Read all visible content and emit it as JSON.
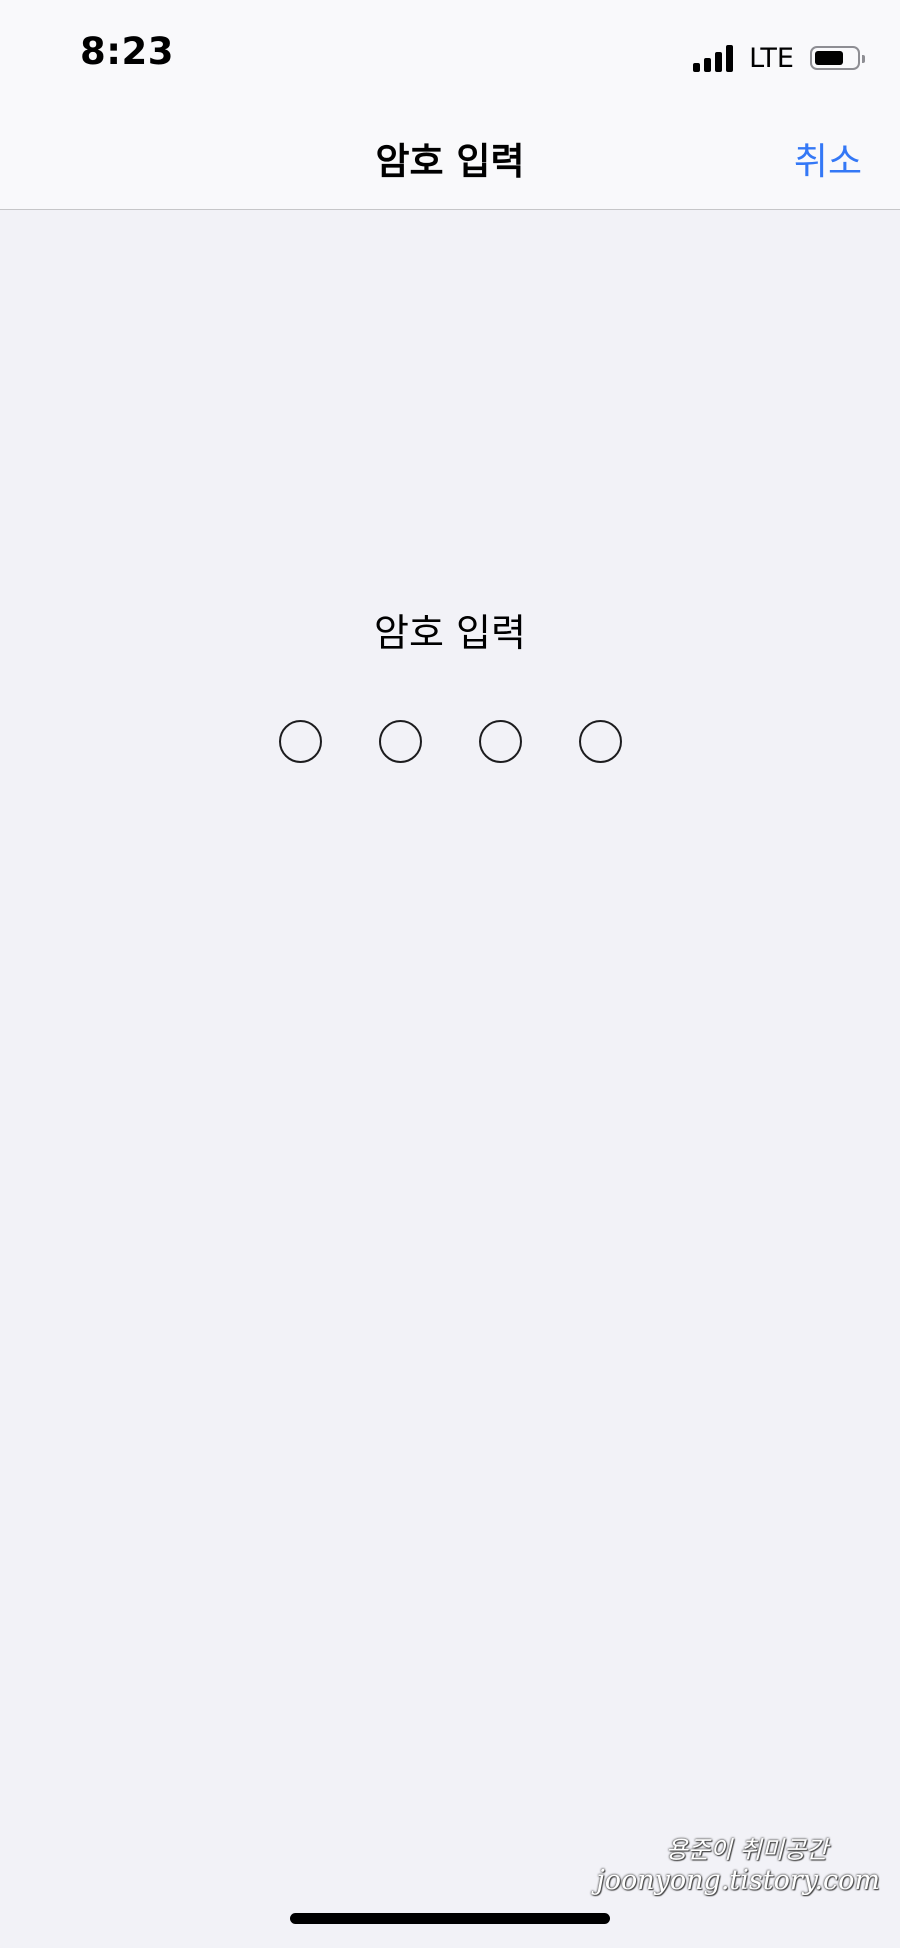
{
  "status_bar": {
    "time": "8:23",
    "network": "LTE",
    "icons": {
      "signal": "signal-bars-icon",
      "battery": "battery-icon"
    }
  },
  "nav": {
    "title": "암호 입력",
    "cancel_label": "취소",
    "accent_color": "#3478f6"
  },
  "passcode": {
    "prompt": "암호 입력",
    "length": 4,
    "entered": 0
  },
  "watermark": {
    "line1": "용준이 취미공간",
    "line2": "joonyong.tistory.com"
  }
}
